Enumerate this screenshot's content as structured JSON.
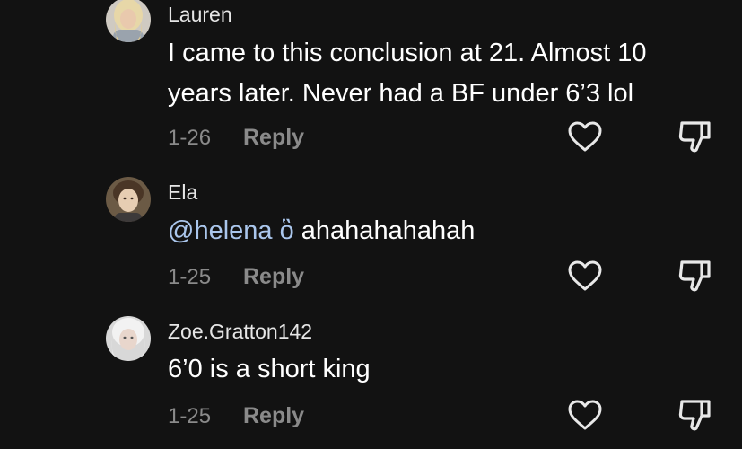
{
  "comments": [
    {
      "username": "Lauren",
      "text": "I came to this conclusion at 21. Almost 10 years later. Never had a BF under 6’3 lol",
      "date": "1-26",
      "reply_label": "Reply",
      "avatar_icon": "user-avatar-blonde"
    },
    {
      "username": "Ela",
      "mention": "@helena",
      "mention_suffix": "ὃ",
      "text": "ahahahahahah",
      "date": "1-25",
      "reply_label": "Reply",
      "avatar_icon": "user-avatar-portrait"
    },
    {
      "username": "Zoe.Gratton142",
      "text": "6’0 is a short king",
      "date": "1-25",
      "reply_label": "Reply",
      "avatar_icon": "user-avatar-light"
    }
  ],
  "icons": {
    "like": "heart-outline-icon",
    "dislike": "thumbs-down-outline-icon"
  },
  "colors": {
    "background": "#121212",
    "mention": "#aac6ec",
    "muted": "#8a8a8a"
  }
}
